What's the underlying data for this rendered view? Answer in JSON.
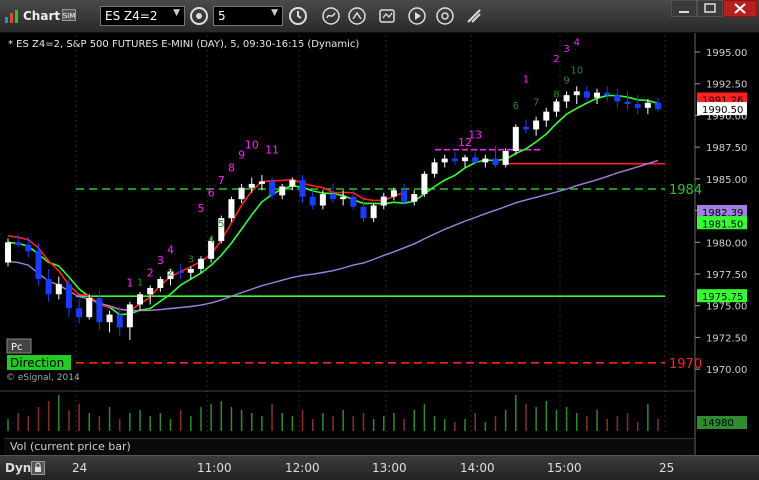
{
  "toolbar": {
    "title": "Chart",
    "symbol": "ES Z4=2",
    "interval": "5"
  },
  "chart": {
    "header": "* ES Z4=2, S&P 500 FUTURES E-MINI (DAY), 5, 09:30-16:15 (Dynamic)",
    "copyright": "© eSignal, 2014",
    "pc_label": "Pc",
    "direction_label": "Direction",
    "y_ticks": [
      "1995.00",
      "1992.50",
      "1990.00",
      "1987.50",
      "1985.00",
      "1982.50",
      "1980.00",
      "1977.50",
      "1975.00",
      "1972.50",
      "1970.00"
    ],
    "price_tags": {
      "last_red": "1991.26",
      "last": "1990.50",
      "purple": "1982.39",
      "green": "1981.50",
      "support": "1975.75",
      "vol": "14980"
    },
    "levels": {
      "upper": "1984",
      "lower": "1970"
    },
    "colors": {
      "up": "#ffffff",
      "down": "#1a3cff",
      "ma_green": "#33ff33",
      "ma_red": "#ff2020",
      "ma_purple": "#a080e0",
      "level_green": "#22cc22",
      "level_red": "#ff2020",
      "magenta": "#ff22ff",
      "count_green": "#228822"
    }
  },
  "vol_label": "Vol (current price bar)",
  "bottom": {
    "dyn": "Dyn",
    "times": [
      "24",
      "11:00",
      "12:00",
      "13:00",
      "14:00",
      "15:00",
      "25"
    ]
  },
  "chart_data": {
    "type": "candlestick",
    "y_range": [
      1969.3,
      1996.5
    ],
    "candles": [
      [
        1978.4,
        1980.3,
        1978.1,
        1980.0
      ],
      [
        1980.0,
        1980.6,
        1979.6,
        1979.8
      ],
      [
        1979.8,
        1980.4,
        1978.8,
        1979.3
      ],
      [
        1979.3,
        1979.9,
        1976.6,
        1977.1
      ],
      [
        1977.1,
        1977.9,
        1975.3,
        1975.9
      ],
      [
        1975.9,
        1977.3,
        1975.5,
        1976.7
      ],
      [
        1976.7,
        1977.1,
        1974.1,
        1974.8
      ],
      [
        1974.8,
        1975.5,
        1973.6,
        1974.1
      ],
      [
        1974.1,
        1975.9,
        1973.9,
        1975.6
      ],
      [
        1975.6,
        1976.2,
        1973.1,
        1973.7
      ],
      [
        1973.7,
        1974.6,
        1972.9,
        1974.3
      ],
      [
        1974.3,
        1974.9,
        1972.6,
        1973.3
      ],
      [
        1973.3,
        1975.3,
        1972.3,
        1975.1
      ],
      [
        1975.1,
        1976.1,
        1974.6,
        1975.9
      ],
      [
        1975.9,
        1976.6,
        1975.1,
        1976.4
      ],
      [
        1976.4,
        1977.3,
        1976.1,
        1977.1
      ],
      [
        1977.1,
        1977.9,
        1976.6,
        1977.7
      ],
      [
        1977.7,
        1978.3,
        1977.1,
        1977.6
      ],
      [
        1977.6,
        1978.1,
        1977.1,
        1977.9
      ],
      [
        1977.9,
        1978.9,
        1977.6,
        1978.7
      ],
      [
        1978.7,
        1980.4,
        1978.4,
        1980.1
      ],
      [
        1980.1,
        1982.1,
        1979.9,
        1981.9
      ],
      [
        1981.9,
        1983.6,
        1981.6,
        1983.4
      ],
      [
        1983.4,
        1984.6,
        1983.1,
        1984.3
      ],
      [
        1984.3,
        1985.1,
        1983.9,
        1984.6
      ],
      [
        1984.6,
        1985.3,
        1984.1,
        1984.8
      ],
      [
        1984.8,
        1985.1,
        1983.4,
        1983.7
      ],
      [
        1983.7,
        1984.6,
        1983.4,
        1984.4
      ],
      [
        1984.4,
        1985.1,
        1984.1,
        1984.9
      ],
      [
        1984.9,
        1985.3,
        1983.1,
        1983.6
      ],
      [
        1983.6,
        1984.1,
        1982.6,
        1982.9
      ],
      [
        1982.9,
        1984.1,
        1982.6,
        1983.8
      ],
      [
        1983.8,
        1984.6,
        1983.1,
        1983.4
      ],
      [
        1983.4,
        1984.1,
        1982.9,
        1983.6
      ],
      [
        1983.6,
        1984.1,
        1982.6,
        1982.8
      ],
      [
        1982.8,
        1983.3,
        1981.6,
        1981.9
      ],
      [
        1981.9,
        1983.1,
        1981.6,
        1982.9
      ],
      [
        1982.9,
        1983.9,
        1982.6,
        1983.6
      ],
      [
        1983.6,
        1984.3,
        1983.3,
        1984.1
      ],
      [
        1984.1,
        1984.6,
        1982.9,
        1983.2
      ],
      [
        1983.2,
        1984.1,
        1982.9,
        1983.8
      ],
      [
        1983.8,
        1985.6,
        1983.6,
        1985.4
      ],
      [
        1985.4,
        1986.6,
        1985.1,
        1986.3
      ],
      [
        1986.3,
        1986.9,
        1985.9,
        1986.6
      ],
      [
        1986.6,
        1987.1,
        1986.1,
        1986.4
      ],
      [
        1986.4,
        1986.9,
        1985.9,
        1986.7
      ],
      [
        1986.7,
        1987.1,
        1986.1,
        1986.3
      ],
      [
        1986.3,
        1986.9,
        1985.9,
        1986.6
      ],
      [
        1986.6,
        1987.6,
        1985.9,
        1986.1
      ],
      [
        1986.1,
        1987.4,
        1985.9,
        1987.2
      ],
      [
        1987.2,
        1989.3,
        1986.9,
        1989.1
      ],
      [
        1989.1,
        1989.7,
        1988.6,
        1988.9
      ],
      [
        1988.9,
        1989.9,
        1988.4,
        1989.6
      ],
      [
        1989.6,
        1990.6,
        1989.1,
        1990.3
      ],
      [
        1990.3,
        1991.3,
        1989.9,
        1991.1
      ],
      [
        1991.1,
        1991.9,
        1990.6,
        1991.6
      ],
      [
        1991.6,
        1992.3,
        1990.9,
        1991.9
      ],
      [
        1991.9,
        1992.3,
        1991.1,
        1991.4
      ],
      [
        1991.4,
        1992.1,
        1990.9,
        1991.8
      ],
      [
        1991.8,
        1992.3,
        1991.1,
        1991.6
      ],
      [
        1991.6,
        1992.1,
        1990.6,
        1991.1
      ],
      [
        1991.1,
        1991.9,
        1990.4,
        1990.9
      ],
      [
        1990.9,
        1991.6,
        1990.1,
        1990.6
      ],
      [
        1990.6,
        1991.3,
        1990.1,
        1991.0
      ],
      [
        1991.0,
        1991.4,
        1990.3,
        1990.5
      ]
    ],
    "volume": [
      4,
      6,
      5,
      8,
      10,
      12,
      7,
      9,
      6,
      5,
      8,
      4,
      6,
      7,
      5,
      6,
      4,
      7,
      5,
      8,
      9,
      10,
      8,
      7,
      6,
      5,
      9,
      6,
      5,
      7,
      4,
      6,
      5,
      7,
      5,
      6,
      4,
      5,
      6,
      4,
      7,
      9,
      5,
      4,
      3,
      4,
      6,
      3,
      5,
      7,
      12,
      9,
      8,
      10,
      7,
      8,
      6,
      5,
      7,
      4,
      5,
      6,
      3,
      9,
      4
    ],
    "counts": [
      "1",
      "2",
      "3",
      "4",
      "5",
      "6",
      "7",
      "8",
      "9",
      "10",
      "11",
      "12",
      "13"
    ]
  }
}
